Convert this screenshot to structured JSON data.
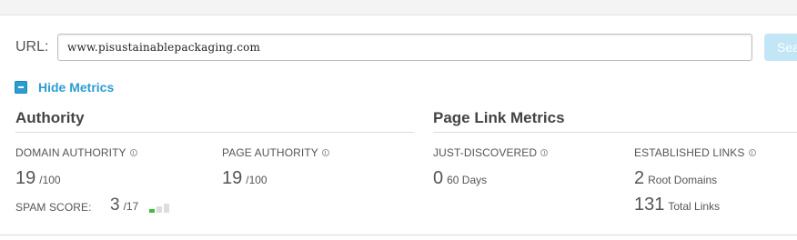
{
  "search": {
    "label": "URL:",
    "value": "www.pisustainablepackaging.com",
    "button_label": "Search"
  },
  "toggle": {
    "label": "Hide Metrics"
  },
  "authority": {
    "title": "Authority",
    "domain_authority": {
      "label": "DOMAIN AUTHORITY",
      "value": "19",
      "suffix": "/100"
    },
    "page_authority": {
      "label": "PAGE AUTHORITY",
      "value": "19",
      "suffix": "/100"
    },
    "spam_score": {
      "label": "SPAM SCORE:",
      "value": "3",
      "suffix": "/17",
      "level": 1,
      "max_level": 3
    }
  },
  "page_link_metrics": {
    "title": "Page Link Metrics",
    "just_discovered": {
      "label": "JUST-DISCOVERED",
      "value": "0",
      "suffix": "60 Days"
    },
    "established_links": {
      "label": "ESTABLISHED LINKS",
      "root_domains": {
        "value": "2",
        "suffix": "Root Domains"
      },
      "total_links": {
        "value": "131",
        "suffix": "Total Links"
      }
    }
  },
  "colors": {
    "accent": "#2d9cd3",
    "spam_low": "#3cc03c",
    "spam_empty": "#dddddd"
  }
}
